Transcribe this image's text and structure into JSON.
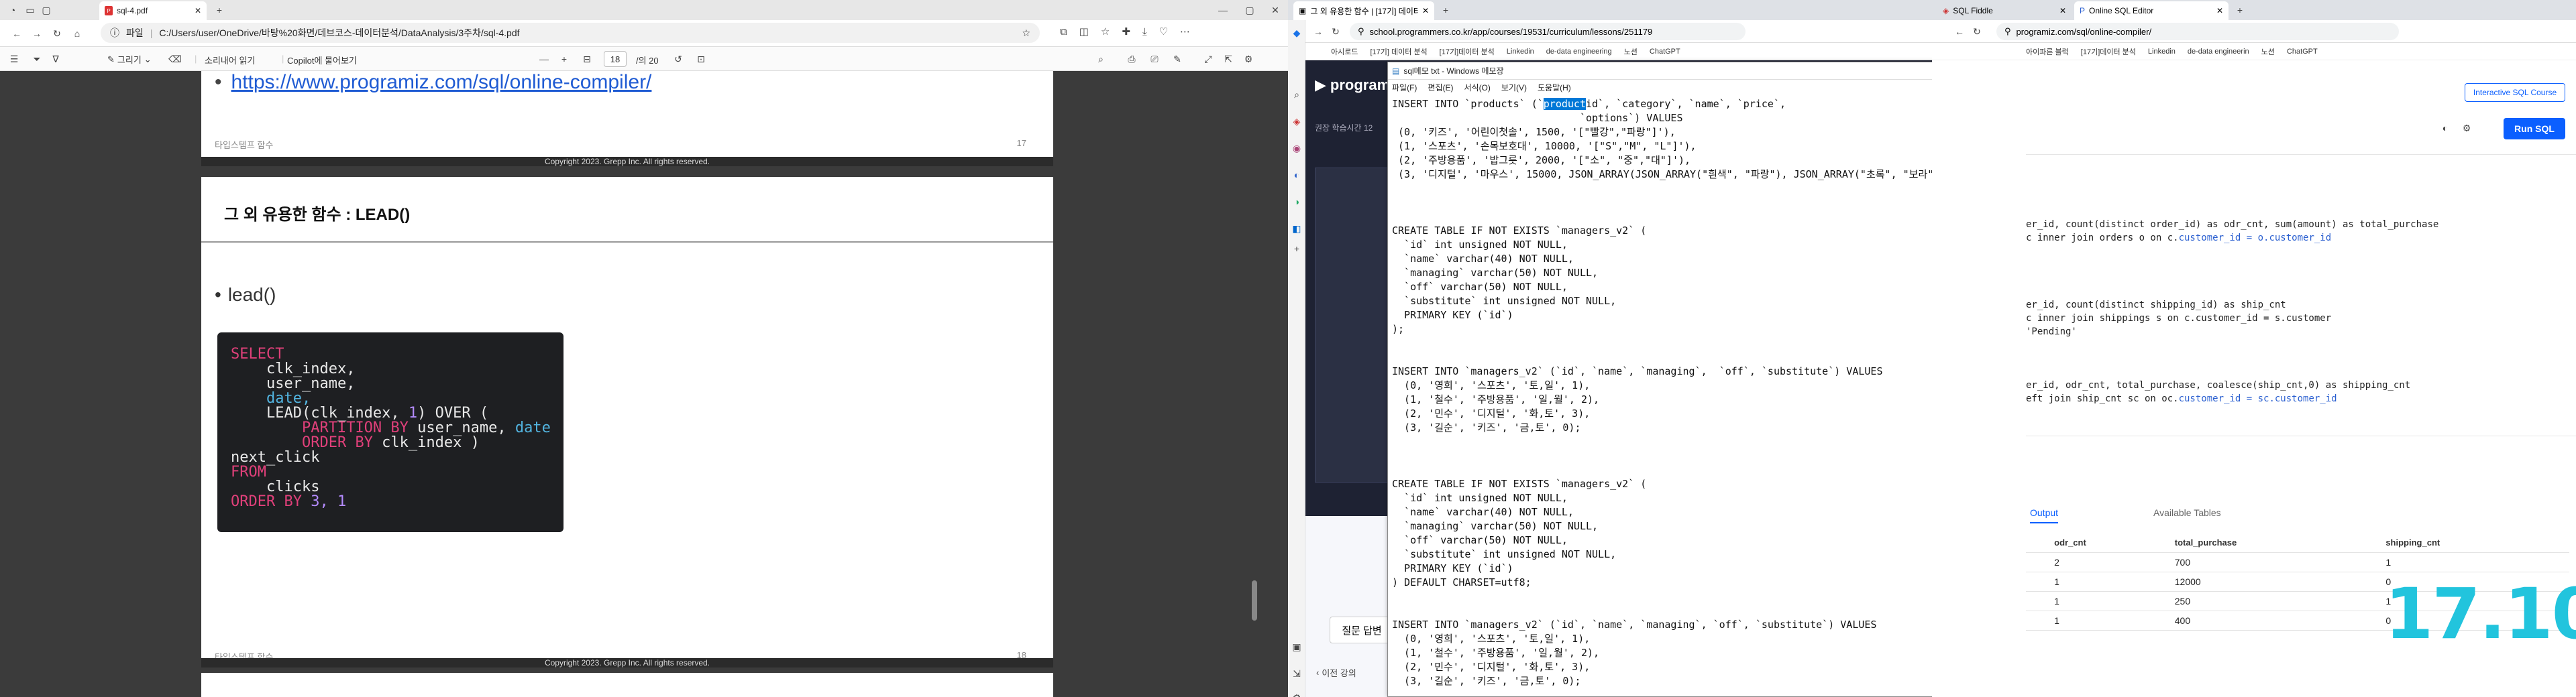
{
  "edge": {
    "tab_title": "sql-4.pdf",
    "address_label": "파일",
    "address_url": "C:/Users/user/OneDrive/바탕%20화면/데브코스-데이터분석/DataAnalysis/3주차/sql-4.pdf",
    "toolbar": {
      "draw_label": "그리기",
      "read_aloud_label": "소리내어 읽기",
      "copilot_label": "Copilot에 물어보기",
      "page_current": "18",
      "page_total": "/의 20"
    },
    "page17": {
      "link": "https://www.programiz.com/sql/online-compiler/",
      "footer_left": "타입스템프 함수",
      "footer_right": "17",
      "copyright": "Copyright 2023. Grepp Inc. All rights reserved."
    },
    "page18": {
      "title": "그 외 유용한 함수 : LEAD()",
      "bullet": "lead()",
      "footer_left": "타입스템프 함수",
      "footer_right": "18",
      "copyright": "Copyright 2023. Grepp Inc. All rights reserved."
    }
  },
  "code_block": {
    "l1": "SELECT",
    "l2": "clk_index,",
    "l3": "user_name,",
    "l4": "date,",
    "l5a": "LEAD(clk_index, ",
    "l5n": "1",
    "l5b": ") OVER (",
    "l6a": "PARTITION BY",
    "l6b": " user_name, ",
    "l6c": "date",
    "l7a": "ORDER BY",
    "l7b": " clk_index )",
    "l8": "next_click",
    "l9": "FROM",
    "l10": "clicks",
    "l11a": "ORDER BY",
    "l11n": "3, 1"
  },
  "mid": {
    "tab_title": "그 외 유용한 함수 | [17기] 데이터",
    "url": "school.programmers.co.kr/app/courses/19531/curriculum/lessons/251179",
    "bookmarks": [
      "아시로드",
      "[17기] 데이터 분석",
      "[17기]데이터 분석",
      "Linkedin",
      "de-data engineering",
      "노션",
      "ChatGPT"
    ],
    "brand": "programm",
    "lesson_time": "권장 학습시간 12",
    "qa_label": "질문 답변",
    "prev_label": "이전 강의"
  },
  "notepad": {
    "title": "sql메모 txt - Windows 메모장",
    "menu": [
      "파일(F)",
      "편집(E)",
      "서식(O)",
      "보기(V)",
      "도움말(H)"
    ],
    "line1_pre": "INSERT INTO `products` (`",
    "line1_sel": "product",
    "line1_post": "id`, `category`, `name`, `price`,",
    "body": "                               `options`) VALUES\n (0, '키즈', '어린이첫솔', 1500, '[\"빨강\",\"파랑\"]'),\n (1, '스포츠', '손목보호대', 10000, '[\"S\",\"M\", \"L\"]'),\n (2, '주방용품', '밥그릇', 2000, '[\"소\", \"중\",\"대\"]'),\n (3, '디지털', '마우스', 15000, JSON_ARRAY(JSON_ARRAY(\"흰색\", \"파랑\"), JSON_ARRAY(\"초록\", \"보라\"), JSON_ARRAY(\"갈색\", \"검\n\n\n\nCREATE TABLE IF NOT EXISTS `managers_v2` (\n  `id` int unsigned NOT NULL,\n  `name` varchar(40) NOT NULL,\n  `managing` varchar(50) NOT NULL,\n  `off` varchar(50) NOT NULL,\n  `substitute` int unsigned NOT NULL,\n  PRIMARY KEY (`id`)\n);\n\n\nINSERT INTO `managers_v2` (`id`, `name`, `managing`,  `off`, `substitute`) VALUES\n  (0, '영희', '스포츠', '토,일', 1),\n  (1, '철수', '주방용품', '일,월', 2),\n  (2, '민수', '디지털', '화,토', 3),\n  (3, '길순', '키즈', '금,토', 0);\n\n\n\nCREATE TABLE IF NOT EXISTS `managers_v2` (\n  `id` int unsigned NOT NULL,\n  `name` varchar(40) NOT NULL,\n  `managing` varchar(50) NOT NULL,\n  `off` varchar(50) NOT NULL,\n  `substitute` int unsigned NOT NULL,\n  PRIMARY KEY (`id`)\n) DEFAULT CHARSET=utf8;\n\n\nINSERT INTO `managers_v2` (`id`, `name`, `managing`, `off`, `substitute`) VALUES\n  (0, '영희', '스포츠', '토,일', 1),\n  (1, '철수', '주방용품', '일,월', 2),\n  (2, '민수', '디지털', '화,토', 3),\n  (3, '길순', '키즈', '금,토', 0);"
  },
  "right": {
    "tab1": "SQL Fiddle",
    "tab2": "Online SQL Editor",
    "url": "programiz.com/sql/online-compiler/",
    "bookmarks": [
      "아이파른 블럭",
      "[17기]데이터 분석",
      "Linkedin",
      "de-data engineerin",
      "노션",
      "ChatGPT"
    ],
    "interactive_btn": "Interactive SQL Course",
    "run_btn": "Run SQL",
    "output_tab": "Output",
    "tables_tab": "Available Tables",
    "code": [
      {
        "a": "er_id, count(distinct order_id) as odr_cnt, sum(amount) as total_purchase",
        "b": ""
      },
      {
        "a": "c inner join orders o on c.",
        "b": "customer_id = o.customer_id"
      },
      {
        "a": "",
        "b": ""
      },
      {
        "a": "",
        "b": ""
      },
      {
        "a": "",
        "b": ""
      },
      {
        "a": "",
        "b": ""
      },
      {
        "a": "er_id, count(distinct shipping_id) as ship_cnt",
        "b": ""
      },
      {
        "a": "c inner join shippings s on c.customer_id = s.customer",
        "b": ""
      },
      {
        "a": "'Pending'",
        "b": ""
      },
      {
        "a": "",
        "b": ""
      },
      {
        "a": "",
        "b": ""
      },
      {
        "a": "",
        "b": ""
      },
      {
        "a": "er_id, odr_cnt, total_purchase, coalesce(ship_cnt,0) as shipping_cnt",
        "b": ""
      },
      {
        "a": "eft join ship_cnt sc on oc.",
        "b": "customer_id = sc.customer_id"
      }
    ],
    "table_headers": [
      "",
      "odr_cnt",
      "total_purchase",
      "shipping_cnt"
    ],
    "table_rows": [
      [
        "",
        "2",
        "700",
        "1"
      ],
      [
        "",
        "1",
        "12000",
        "0"
      ],
      [
        "",
        "1",
        "250",
        "1"
      ],
      [
        "",
        "1",
        "400",
        "0"
      ]
    ]
  },
  "clock": "17.10",
  "colors": {
    "accent_blue": "#0b5fff",
    "clock": "#22c4dd",
    "code_bg": "#1e1f22"
  }
}
